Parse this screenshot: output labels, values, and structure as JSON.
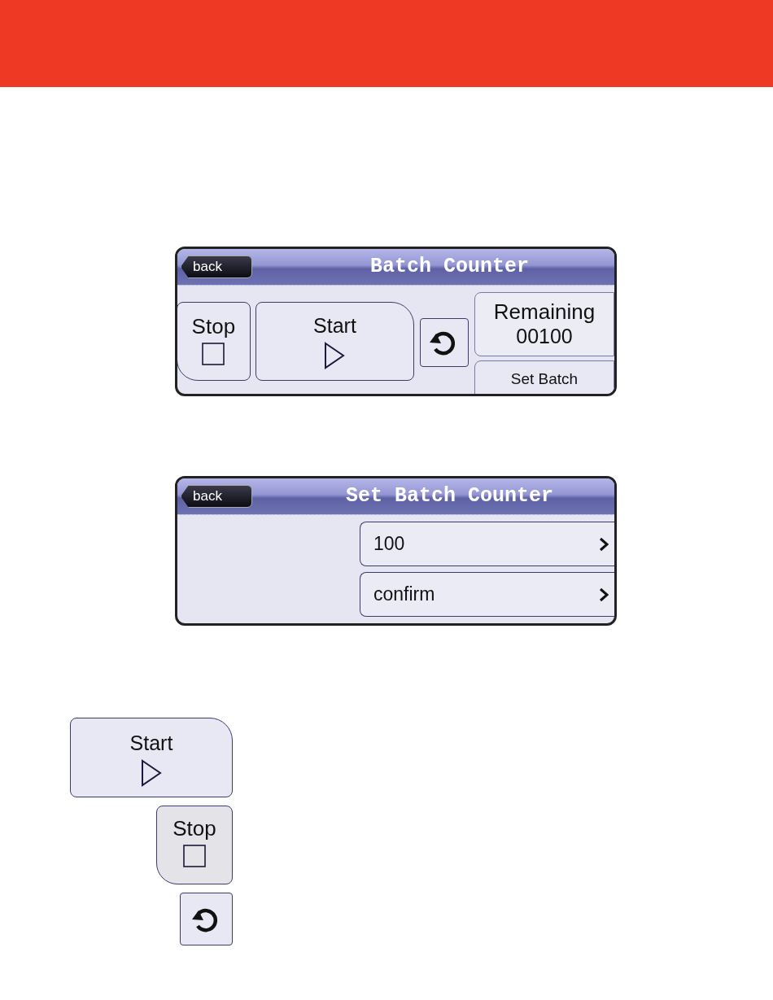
{
  "screens": [
    {
      "kind": "main",
      "back": "back",
      "title": "Batch Counter",
      "stop": "Stop",
      "start": "Start",
      "remaining_label": "Remaining",
      "remaining_value": "00100",
      "set_batch": "Set Batch"
    },
    {
      "kind": "set",
      "back": "back",
      "title": "Set Batch Counter",
      "rows": [
        {
          "label": "100"
        },
        {
          "label": "confirm"
        }
      ]
    }
  ],
  "legend": [
    {
      "kind": "start",
      "label": "Start"
    },
    {
      "kind": "stop",
      "label": "Stop"
    },
    {
      "kind": "reset"
    }
  ]
}
